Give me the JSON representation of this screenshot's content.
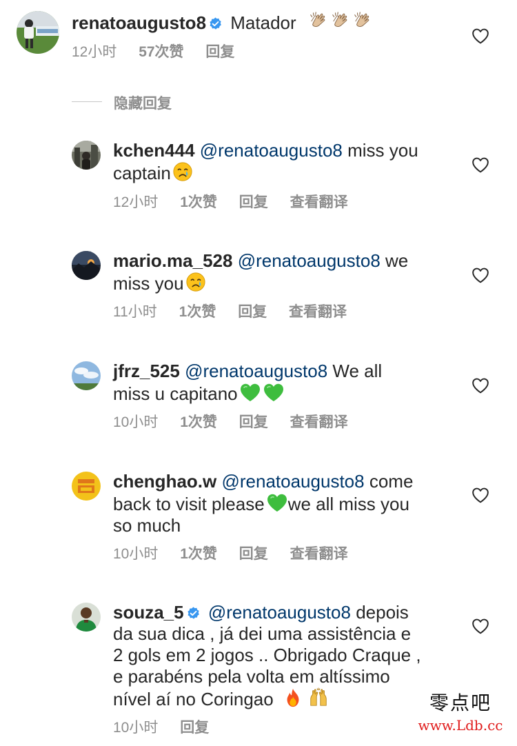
{
  "comments": [
    {
      "username": "renatoaugusto8",
      "verified": true,
      "text": "Matador",
      "emoji": [
        "clapping-hands",
        "clapping-hands",
        "clapping-hands"
      ],
      "time": "12小时",
      "likes": "57次赞",
      "reply_label": "回复",
      "avatar": "soccer-player-avatar"
    },
    {
      "username": "kchen444",
      "mention": "@renatoaugusto8",
      "text_before_break": "miss you",
      "text_after_break": "captain",
      "emoji": [
        "crying-face"
      ],
      "time": "12小时",
      "likes": "1次赞",
      "reply_label": "回复",
      "translate_label": "查看翻译",
      "avatar": "city-street-avatar"
    },
    {
      "username": "mario.ma_528",
      "mention": "@renatoaugusto8",
      "text_before_break": "we",
      "text_after_break": "miss you",
      "emoji": [
        "crying-face"
      ],
      "time": "11小时",
      "likes": "1次赞",
      "reply_label": "回复",
      "translate_label": "查看翻译",
      "avatar": "sunset-avatar"
    },
    {
      "username": "jfrz_525",
      "mention": "@renatoaugusto8",
      "text_before_break": "We all",
      "text_after_break": "miss u capitano",
      "emoji": [
        "green-heart",
        "green-heart"
      ],
      "time": "10小时",
      "likes": "1次赞",
      "reply_label": "回复",
      "translate_label": "查看翻译",
      "avatar": "sky-landscape-avatar"
    },
    {
      "username": "chenghao.w",
      "mention": "@renatoaugusto8",
      "text_line1": "come",
      "text_line2a": "back to visit please",
      "text_line2b": "we all miss you",
      "text_line3": "so much",
      "emoji": [
        "green-heart"
      ],
      "time": "10小时",
      "likes": "1次赞",
      "reply_label": "回复",
      "translate_label": "查看翻译",
      "avatar": "yellow-emblem-avatar"
    },
    {
      "username": "souza_5",
      "verified": true,
      "mention": "@renatoaugusto8",
      "text_line1": "depois",
      "text_line2": "da sua dica , já dei uma assistência e",
      "text_line3": "2 gols em 2 jogos .. Obrigado Craque ,",
      "text_line4": "e parabéns pela volta em altíssimo",
      "text_line5": "nível aí no Coringao",
      "emoji": [
        "fire",
        "raising-hands"
      ],
      "time": "10小时",
      "reply_label": "回复",
      "avatar": "green-jersey-avatar"
    }
  ],
  "hide_replies_label": "隐藏回复",
  "watermark": {
    "chinese": "零点吧",
    "url": "www.Ldb.cc"
  },
  "colors": {
    "mention": "#00376b",
    "meta": "#8e8e8e",
    "verified": "#3897f0",
    "text": "#262626"
  }
}
